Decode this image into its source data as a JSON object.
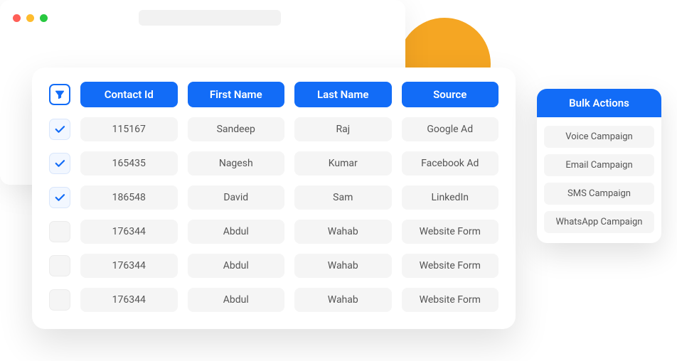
{
  "table": {
    "headers": [
      "Contact Id",
      "First Name",
      "Last Name",
      "Source"
    ],
    "rows": [
      {
        "checked": true,
        "cells": [
          "115167",
          "Sandeep",
          "Raj",
          "Google Ad"
        ]
      },
      {
        "checked": true,
        "cells": [
          "165435",
          "Nagesh",
          "Kumar",
          "Facebook Ad"
        ]
      },
      {
        "checked": true,
        "cells": [
          "186548",
          "David",
          "Sam",
          "LinkedIn"
        ]
      },
      {
        "checked": false,
        "cells": [
          "176344",
          "Abdul",
          "Wahab",
          "Website Form"
        ]
      },
      {
        "checked": false,
        "cells": [
          "176344",
          "Abdul",
          "Wahab",
          "Website Form"
        ]
      },
      {
        "checked": false,
        "cells": [
          "176344",
          "Abdul",
          "Wahab",
          "Website Form"
        ]
      }
    ]
  },
  "bulk": {
    "title": "Bulk Actions",
    "items": [
      "Voice Campaign",
      "Email Campaign",
      "SMS Campaign",
      "WhatsApp Campaign"
    ]
  }
}
